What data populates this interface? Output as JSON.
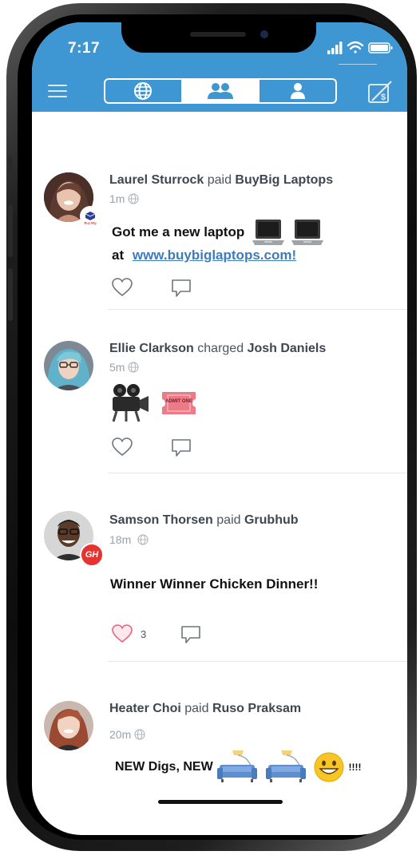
{
  "status_bar": {
    "time": "7:17"
  },
  "header": {
    "menu_icon": "hamburger-menu-icon",
    "tabs": [
      {
        "name": "public",
        "icon": "globe-icon",
        "active": false
      },
      {
        "name": "friends",
        "icon": "friends-icon",
        "active": true
      },
      {
        "name": "personal",
        "icon": "person-icon",
        "active": false
      }
    ],
    "pay_icon": "pay-request-icon"
  },
  "colors": {
    "header_blue": "#3e97d3",
    "link_blue": "#3e7bbd",
    "heart_liked": "#e8647a",
    "text_dark": "#3e4751",
    "meta_gray": "#9aa1a9"
  },
  "posts": [
    {
      "actor": "Laurel Sturrock",
      "verb": "paid",
      "target": "BuyBig Laptops",
      "time": "1m",
      "message_line1": "Got me a new laptop",
      "message_line2_prefix": "at",
      "link": "www.buybiglaptops.com!",
      "badge_text": "Buy Big",
      "emojis": [
        "laptop-icon",
        "laptop-icon"
      ],
      "likes": ""
    },
    {
      "actor": "Ellie Clarkson",
      "verb": "charged",
      "target": "Josh Daniels",
      "time": "5m",
      "ticket_text": "ADMIT ONE",
      "emojis": [
        "movie-camera-icon",
        "ticket-icon"
      ],
      "likes": ""
    },
    {
      "actor": "Samson Thorsen",
      "verb": "paid",
      "target": "Grubhub",
      "time": "18m",
      "badge_text": "GH",
      "message": "Winner Winner Chicken Dinner!!",
      "likes": "3"
    },
    {
      "actor": "Heater Choi",
      "verb": "paid",
      "target": "Ruso Praksam",
      "time": "20m",
      "message_prefix": "NEW Digs, NEW",
      "message_suffix": "!!!!",
      "emojis": [
        "couch-lamp-icon",
        "couch-lamp-icon",
        "grinning-face-icon"
      ]
    }
  ]
}
